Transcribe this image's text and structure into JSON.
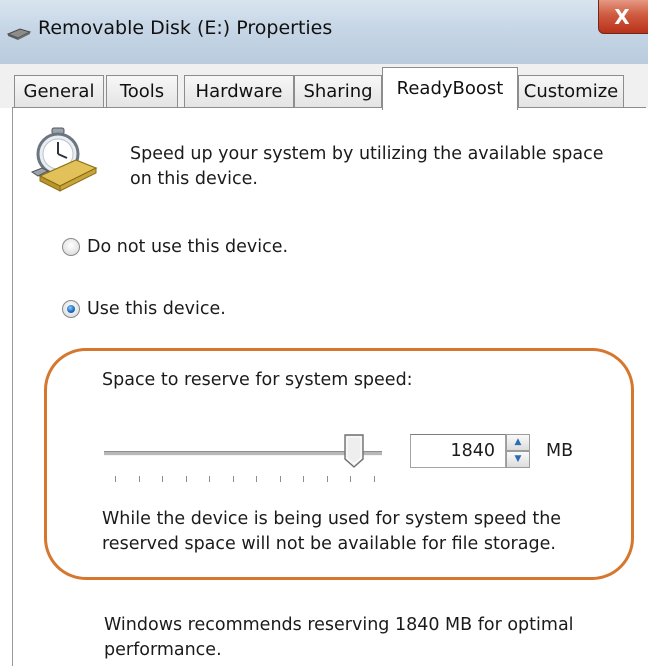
{
  "window": {
    "title": "Removable Disk (E:) Properties",
    "close_glyph": "X",
    "icons": {
      "title": "removable-drive-icon",
      "feature": "readyboost-stopwatch-icon"
    }
  },
  "tabs": [
    {
      "label": "General",
      "active": false
    },
    {
      "label": "Tools",
      "active": false
    },
    {
      "label": "Hardware",
      "active": false
    },
    {
      "label": "Sharing",
      "active": false
    },
    {
      "label": "ReadyBoost",
      "active": true
    },
    {
      "label": "Customize",
      "active": false
    }
  ],
  "readyboost": {
    "intro": "Speed up your system by utilizing the available space on this device.",
    "options": [
      {
        "label": "Do not use this device.",
        "checked": false
      },
      {
        "label": "Use this device.",
        "checked": true
      }
    ],
    "reserve_label": "Space to reserve for system speed:",
    "slider_level": 0.9,
    "reserve_value": "1840",
    "unit": "MB",
    "warning": "While the device is being used for system speed the reserved space will not be available for file storage.",
    "recommendation": "Windows recommends reserving 1840 MB for optimal performance.",
    "colors": {
      "highlight": "#d5772f",
      "radio_selected": "#1b6fc4"
    }
  }
}
